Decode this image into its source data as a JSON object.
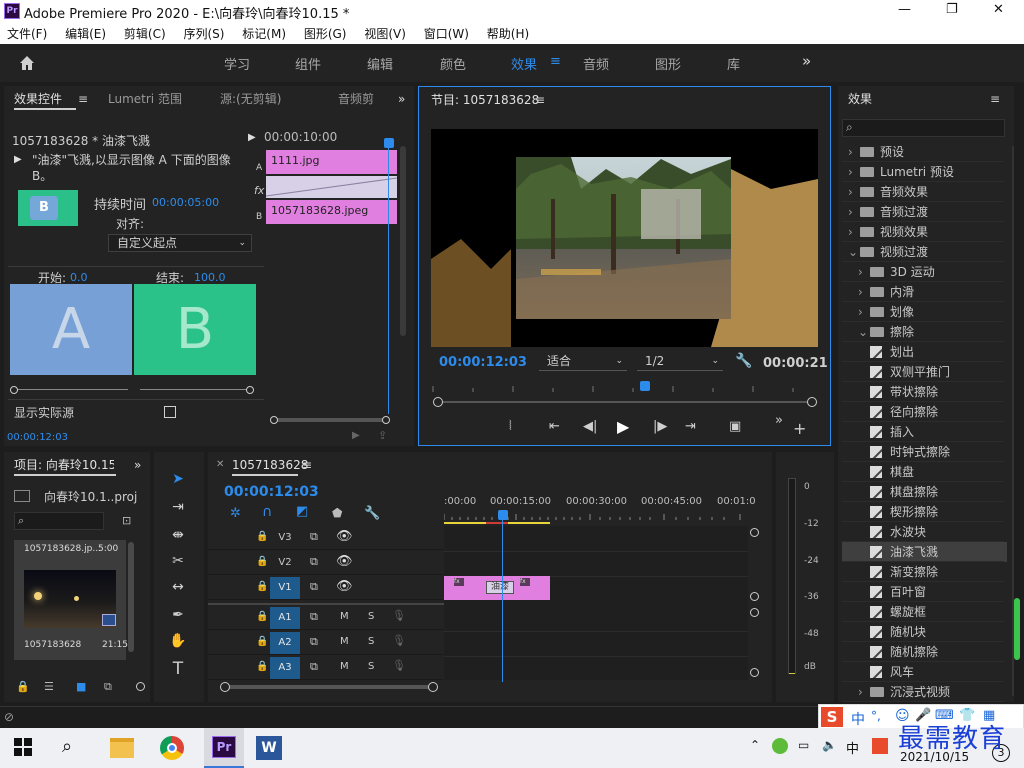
{
  "app": {
    "logo": "Pr",
    "title": "Adobe Premiere Pro 2020 - E:\\向春玲\\向春玲10.15 *"
  },
  "window_controls": {
    "minimize": "—",
    "maximize": "❐",
    "close": "✕"
  },
  "menu": [
    "文件(F)",
    "编辑(E)",
    "剪辑(C)",
    "序列(S)",
    "标记(M)",
    "图形(G)",
    "视图(V)",
    "窗口(W)",
    "帮助(H)"
  ],
  "workspaces": {
    "tabs": [
      "学习",
      "组件",
      "编辑",
      "颜色",
      "效果",
      "音频",
      "图形",
      "库"
    ],
    "active": "效果",
    "more": "»"
  },
  "effect_controls": {
    "tabs": [
      "效果控件",
      "Lumetri 范围",
      "源:(无剪辑)",
      "音频剪"
    ],
    "clip_name": "1057183628 * 油漆飞溅",
    "timecode_start": "00:00:10:00",
    "description": "\"油漆\"飞溅,以显示图像 A 下面的图像 B。",
    "duration_label": "持续时间",
    "duration_value": "00:00:05:00",
    "align_label": "对齐:",
    "align_value": "自定义起点",
    "start_label": "开始:",
    "start_value": "0.0",
    "end_label": "结束:",
    "end_value": "100.0",
    "a_letter": "A",
    "b_letter": "B",
    "show_actual_sources": "显示实际源",
    "clip_a": "1111.jpg",
    "clip_b": "1057183628.jpeg",
    "track_a": "A",
    "track_b": "B",
    "fx": "fx",
    "footer_timecode": "00:00:12:03"
  },
  "program_monitor": {
    "title": "节目: 1057183628",
    "timecode": "00:00:12:03",
    "fit": "适合",
    "resolution": "1/2",
    "duration": "00:00:21"
  },
  "project": {
    "title": "项目: 向春玲10.15",
    "file": "向春玲10.1..proj",
    "thumb_label": "1057183628.jp...",
    "thumb_dur": "5:00",
    "clip_name": "1057183628",
    "clip_dur": "21:15"
  },
  "timeline": {
    "title": "1057183628",
    "timecode": "00:00:12:03",
    "ruler": [
      ":00:00",
      "00:00:15:00",
      "00:00:30:00",
      "00:00:45:00",
      "00:01:0"
    ],
    "video_tracks": [
      "V3",
      "V2",
      "V1"
    ],
    "audio_tracks": [
      "A1",
      "A2",
      "A3"
    ],
    "m": "M",
    "s": "S",
    "transition_label": "油漆"
  },
  "audio_meter": [
    "0",
    "-12",
    "-24",
    "-36",
    "-48",
    "dB"
  ],
  "effects": {
    "title": "效果",
    "items": [
      {
        "label": "预设",
        "level": 0,
        "type": "folder",
        "open": false
      },
      {
        "label": "Lumetri 预设",
        "level": 0,
        "type": "folder",
        "open": false
      },
      {
        "label": "音频效果",
        "level": 0,
        "type": "folder",
        "open": false
      },
      {
        "label": "音频过渡",
        "level": 0,
        "type": "folder",
        "open": false
      },
      {
        "label": "视频效果",
        "level": 0,
        "type": "folder",
        "open": false
      },
      {
        "label": "视频过渡",
        "level": 0,
        "type": "folder",
        "open": true
      },
      {
        "label": "3D 运动",
        "level": 1,
        "type": "folder",
        "open": false
      },
      {
        "label": "内滑",
        "level": 1,
        "type": "folder",
        "open": false
      },
      {
        "label": "划像",
        "level": 1,
        "type": "folder",
        "open": false
      },
      {
        "label": "擦除",
        "level": 1,
        "type": "folder",
        "open": true
      },
      {
        "label": "划出",
        "level": 2,
        "type": "preset"
      },
      {
        "label": "双侧平推门",
        "level": 2,
        "type": "preset"
      },
      {
        "label": "带状擦除",
        "level": 2,
        "type": "preset"
      },
      {
        "label": "径向擦除",
        "level": 2,
        "type": "preset"
      },
      {
        "label": "插入",
        "level": 2,
        "type": "preset"
      },
      {
        "label": "时钟式擦除",
        "level": 2,
        "type": "preset"
      },
      {
        "label": "棋盘",
        "level": 2,
        "type": "preset"
      },
      {
        "label": "棋盘擦除",
        "level": 2,
        "type": "preset"
      },
      {
        "label": "楔形擦除",
        "level": 2,
        "type": "preset"
      },
      {
        "label": "水波块",
        "level": 2,
        "type": "preset"
      },
      {
        "label": "油漆飞溅",
        "level": 2,
        "type": "preset",
        "selected": true
      },
      {
        "label": "渐变擦除",
        "level": 2,
        "type": "preset"
      },
      {
        "label": "百叶窗",
        "level": 2,
        "type": "preset"
      },
      {
        "label": "螺旋框",
        "level": 2,
        "type": "preset"
      },
      {
        "label": "随机块",
        "level": 2,
        "type": "preset"
      },
      {
        "label": "随机擦除",
        "level": 2,
        "type": "preset"
      },
      {
        "label": "风车",
        "level": 2,
        "type": "preset"
      },
      {
        "label": "沉浸式视频",
        "level": 1,
        "type": "folder",
        "open": false
      }
    ]
  },
  "ime": {
    "logo": "S",
    "lang": "中",
    "punct": "°,"
  },
  "watermark": "最需教育",
  "taskbar": {
    "date": "2021/10/15",
    "tray_lang": "中",
    "notif_count": "3",
    "pr_label": "Pr",
    "word_label": "W"
  },
  "colors": {
    "accent": "#2d8ceb",
    "clip": "#e17fe0",
    "playhead": "#2d8ceb"
  }
}
